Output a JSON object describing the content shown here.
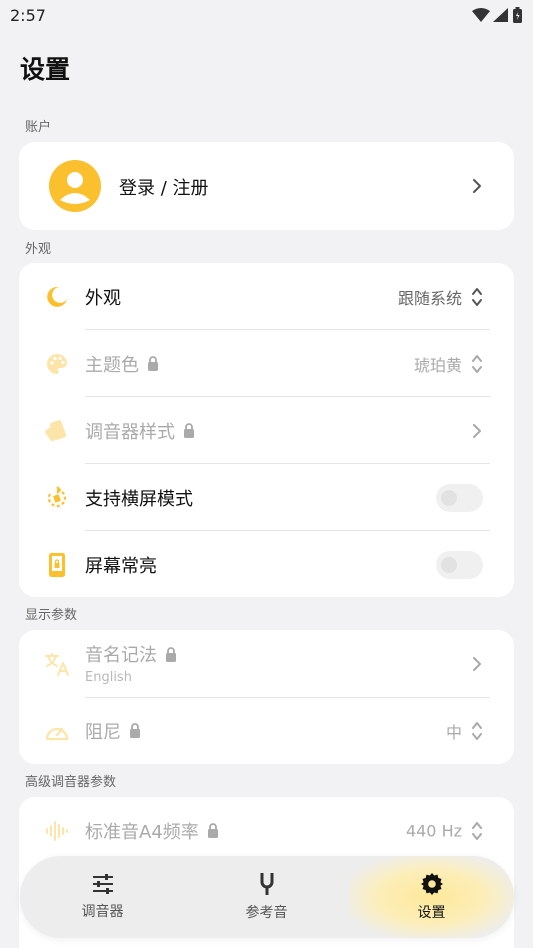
{
  "status": {
    "time": "2:57"
  },
  "page": {
    "title": "设置"
  },
  "colors": {
    "accent": "#fbc02d",
    "accent_light": "#fde68a",
    "background": "#f2f2f4"
  },
  "account": {
    "section_label": "账户",
    "login_label": "登录 / 注册",
    "icon": "avatar-icon"
  },
  "appearance": {
    "section_label": "外观",
    "items": [
      {
        "label": "外观",
        "value": "跟随系统",
        "icon": "moon-icon",
        "locked": false,
        "trailing": "updown"
      },
      {
        "label": "主题色",
        "value": "琥珀黄",
        "icon": "palette-icon",
        "locked": true,
        "trailing": "updown"
      },
      {
        "label": "调音器样式",
        "value": "",
        "icon": "tuner-style-icon",
        "locked": true,
        "trailing": "chevron"
      },
      {
        "label": "支持横屏模式",
        "icon": "rotate-icon",
        "locked": false,
        "trailing": "toggle",
        "toggle_on": false
      },
      {
        "label": "屏幕常亮",
        "icon": "screen-on-icon",
        "locked": false,
        "trailing": "toggle",
        "toggle_on": false
      }
    ]
  },
  "display": {
    "section_label": "显示参数",
    "items": [
      {
        "label": "音名记法",
        "sublabel": "English",
        "icon": "translate-icon",
        "locked": true,
        "trailing": "chevron"
      },
      {
        "label": "阻尼",
        "value": "中",
        "icon": "gauge-icon",
        "locked": true,
        "trailing": "updown"
      }
    ]
  },
  "advanced": {
    "section_label": "高级调音器参数",
    "items": [
      {
        "label": "标准音A4频率",
        "value": "440 Hz",
        "icon": "waveform-icon",
        "locked": true,
        "trailing": "updown"
      }
    ]
  },
  "bottom_nav": {
    "items": [
      {
        "label": "调音器",
        "icon": "sliders-icon",
        "active": false
      },
      {
        "label": "参考音",
        "icon": "tuning-fork-icon",
        "active": false
      },
      {
        "label": "设置",
        "icon": "gear-icon",
        "active": true
      }
    ]
  }
}
